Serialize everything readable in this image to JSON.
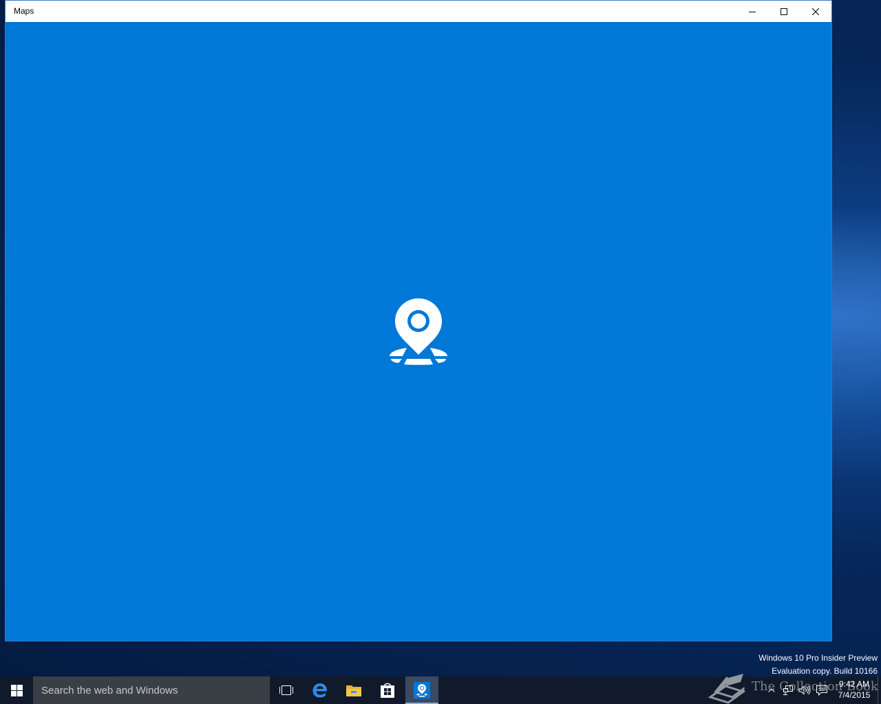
{
  "window": {
    "title": "Maps",
    "buttons": {
      "minimize": "minimize",
      "maximize": "maximize",
      "close": "close"
    },
    "splash_icon": "maps-pin-icon",
    "background_color": "#0078d7"
  },
  "watermark": {
    "line1": "Windows 10 Pro Insider Preview",
    "line2": "Evaluation copy. Build 10166"
  },
  "taskbar": {
    "search_placeholder": "Search the web and Windows",
    "pinned": [
      {
        "name": "task-view",
        "icon": "task-view-icon"
      },
      {
        "name": "edge",
        "icon": "edge-icon"
      },
      {
        "name": "file-explorer",
        "icon": "folder-icon"
      },
      {
        "name": "store",
        "icon": "store-icon"
      },
      {
        "name": "maps",
        "icon": "maps-pin-icon",
        "active": true
      }
    ],
    "overlay_text": "The Collection Book",
    "clock": {
      "time": "9:42 AM",
      "date": "7/4/2015"
    }
  }
}
